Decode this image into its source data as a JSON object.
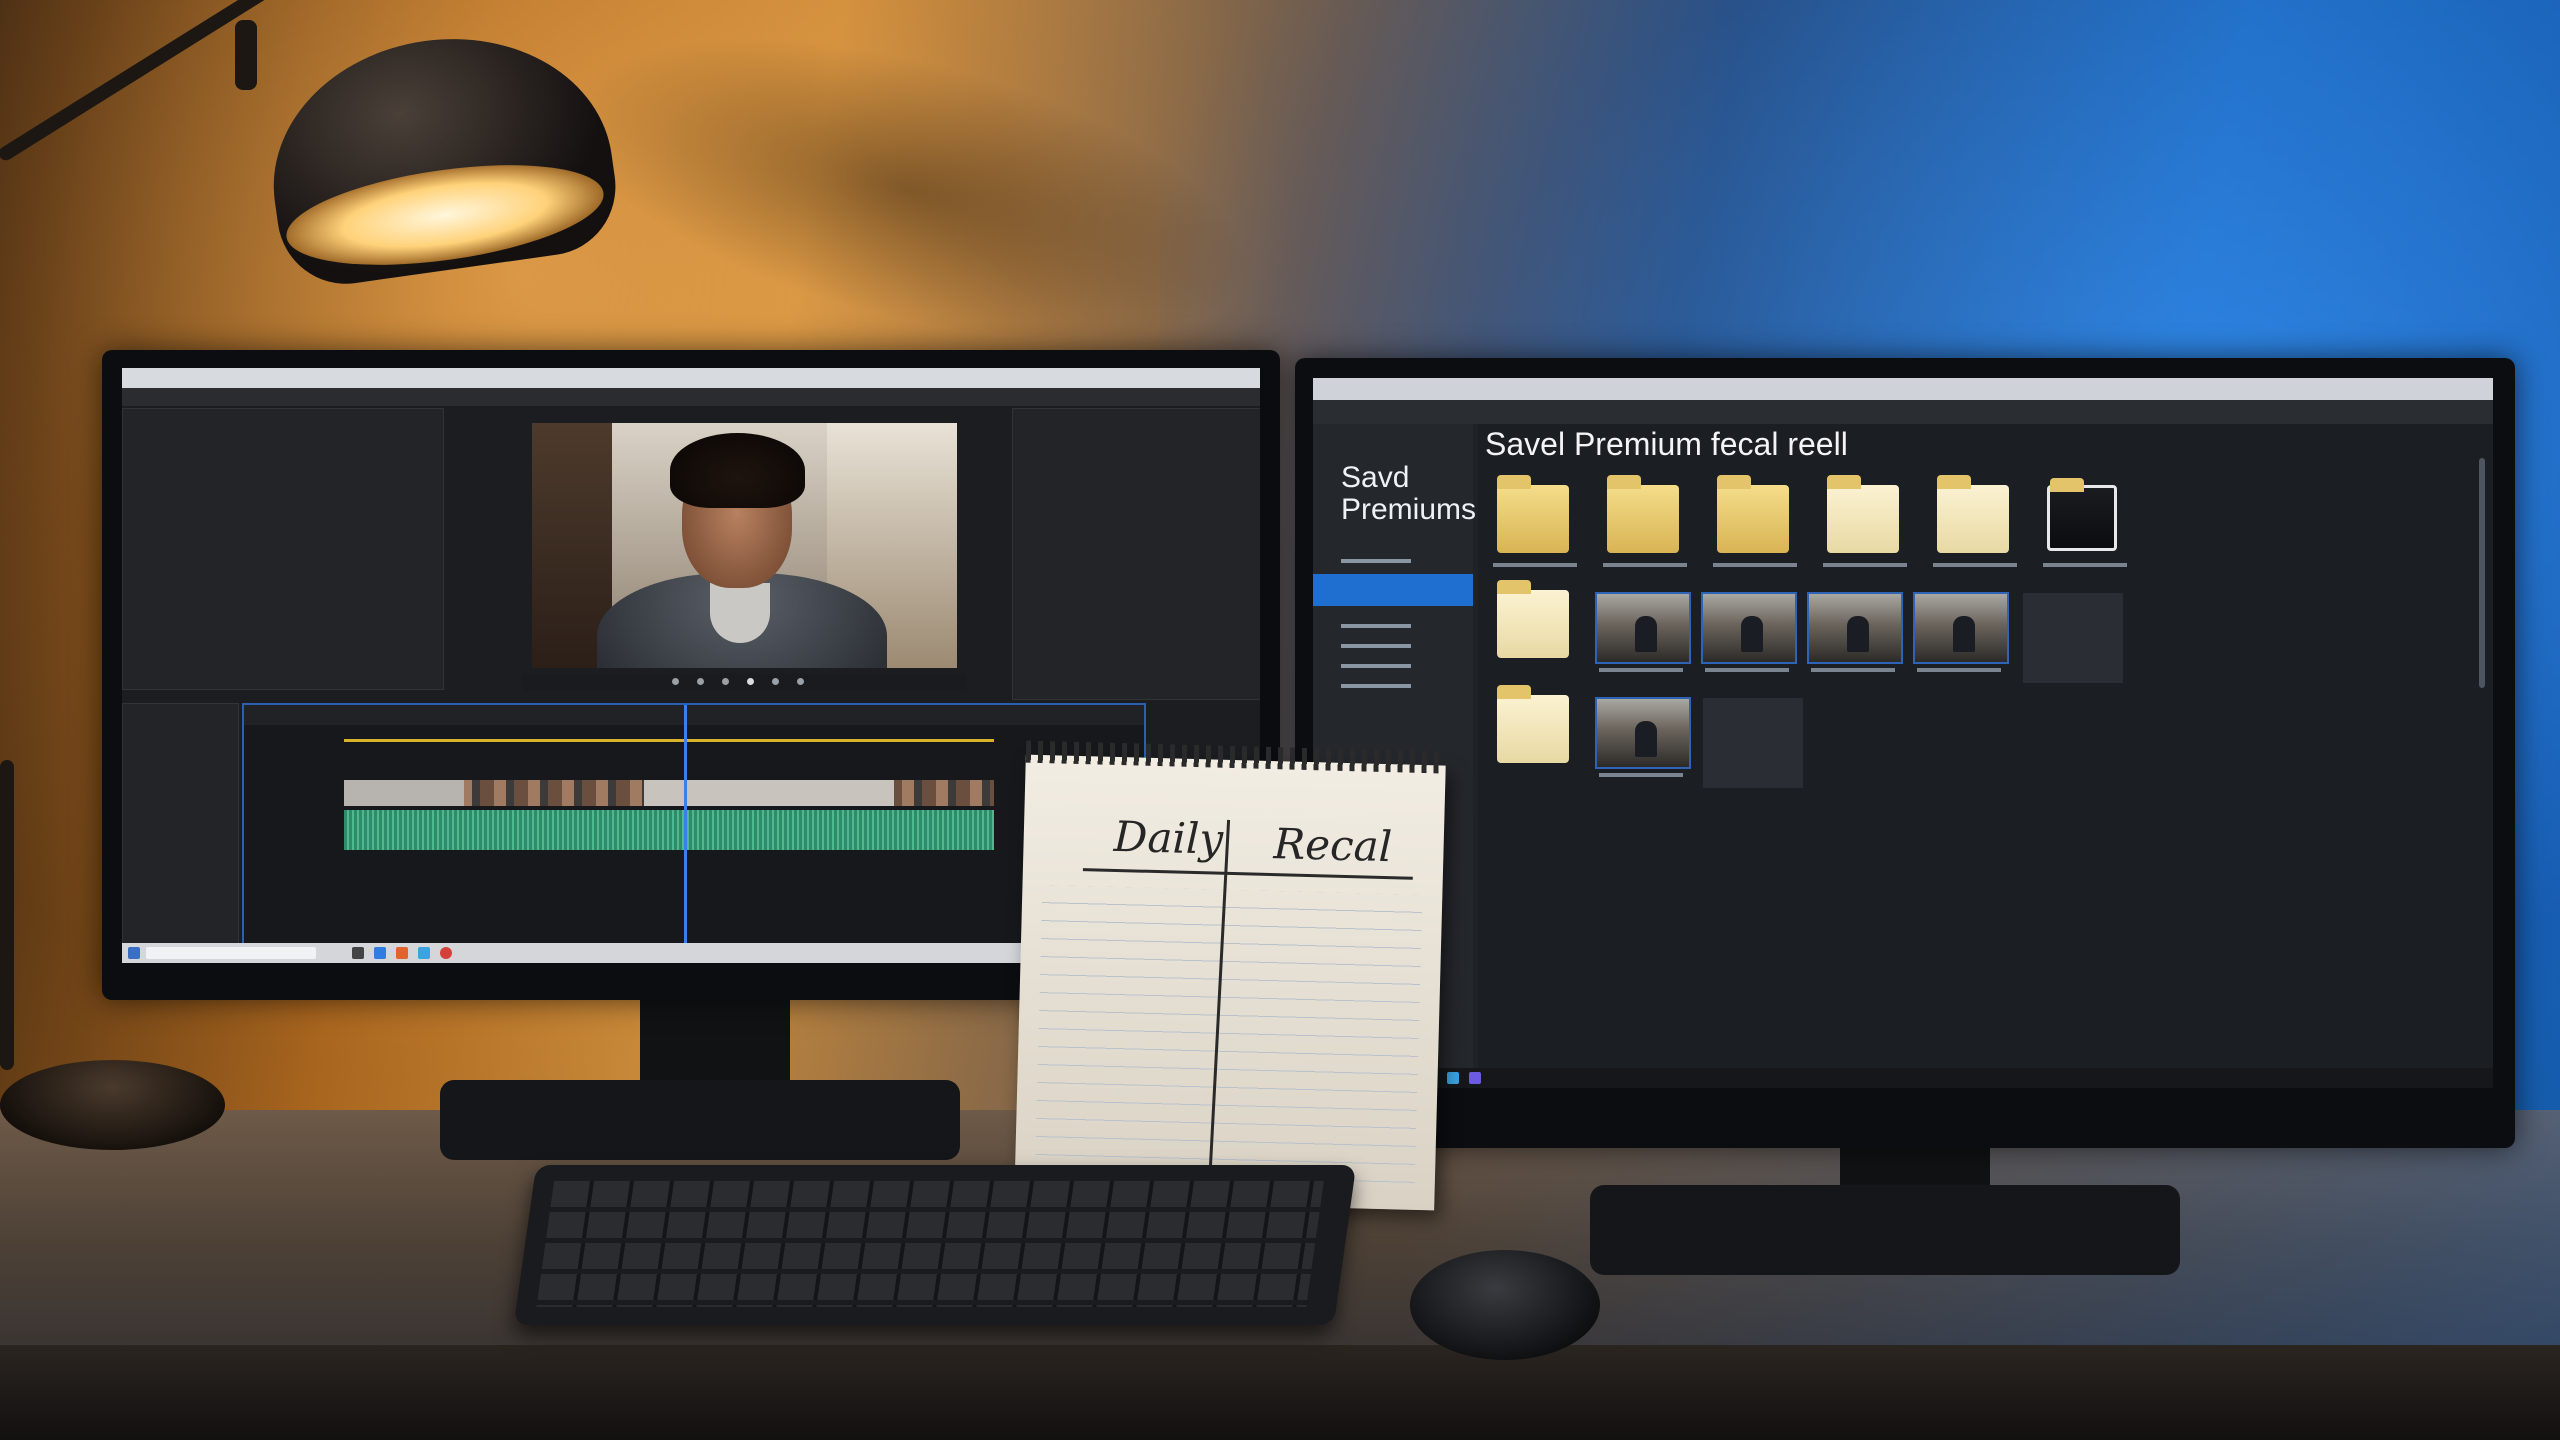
{
  "scene": {
    "description_free": true
  },
  "left_monitor": {
    "app": "video-editor",
    "timeline_clips": [
      "video",
      "audio"
    ]
  },
  "right_monitor": {
    "app": "file-explorer",
    "heading": "Savel Premium fecal reell",
    "nav_title_line1": "Savd",
    "nav_title_line2": "Premiums"
  },
  "notepad": {
    "left_heading": "Daily",
    "right_heading": "Recal"
  },
  "colors": {
    "accent_blue": "#1f6fd1",
    "timeline_border": "#2b5fb0",
    "playhead": "#3b7fe8",
    "audio_clip": "#2e8c6a",
    "folder_yellow": "#e4c46a"
  }
}
